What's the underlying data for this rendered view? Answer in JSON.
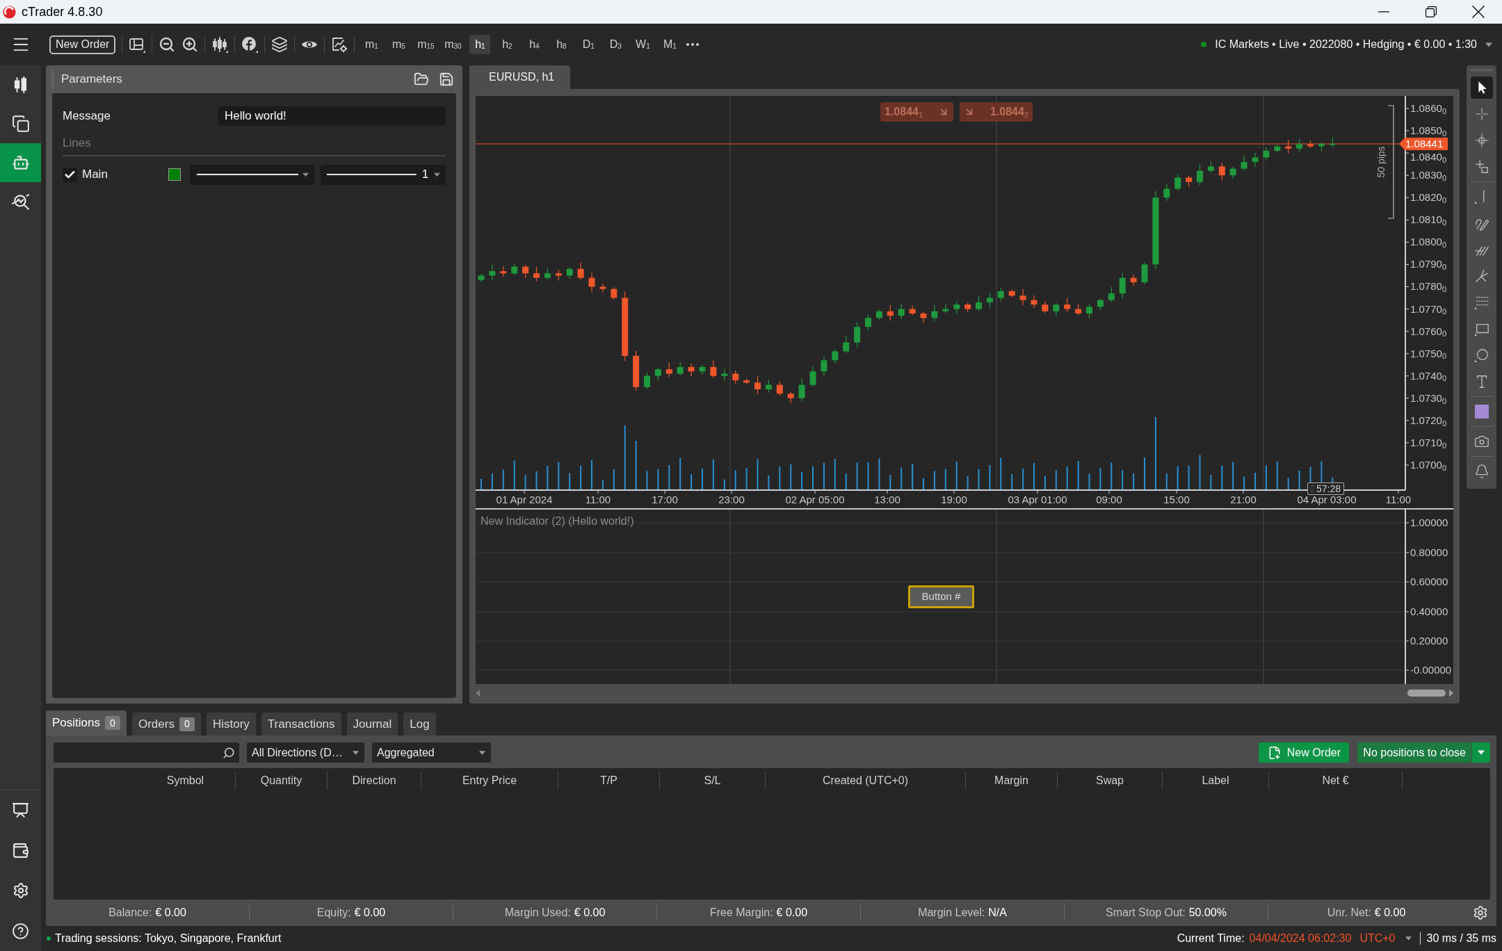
{
  "window": {
    "title": "cTrader 4.8.30"
  },
  "toolbar": {
    "new_order": "New Order",
    "timeframes": [
      {
        "label": "m$_{1}$",
        "selected": false
      },
      {
        "label": "m$_{5}$",
        "selected": false
      },
      {
        "label": "m$_{15}$",
        "selected": false
      },
      {
        "label": "m$_{30}$",
        "selected": false
      },
      {
        "label": "h$_{1}$",
        "selected": true
      },
      {
        "label": "h$_{2}$",
        "selected": false
      },
      {
        "label": "h$_{4}$",
        "selected": false
      },
      {
        "label": "h$_{8}$",
        "selected": false
      },
      {
        "label": "D$_{1}$",
        "selected": false
      },
      {
        "label": "D$_{3}$",
        "selected": false
      },
      {
        "label": "W$_{1}$",
        "selected": false
      },
      {
        "label": "M$_{1}$",
        "selected": false
      }
    ],
    "account": {
      "text": "IC Markets • Live • 2022080 • Hedging • € 0.00 • 1:30",
      "connected": true
    }
  },
  "sidebar": {
    "items": [
      {
        "selected": false
      },
      {
        "selected": false
      },
      {
        "selected": true
      },
      {
        "selected": false
      }
    ]
  },
  "parameters": {
    "title": "Parameters",
    "message": {
      "label": "Message",
      "value": "Hello world!"
    },
    "section": "Lines",
    "lines": [
      {
        "label": "Main",
        "checked": true,
        "color": "#008000",
        "thickness": "1"
      }
    ]
  },
  "chart": {
    "tab": "EURUSD, h1",
    "quick_trade": [
      {
        "kind": "sell",
        "price": "1.0844$_{1}$"
      },
      {
        "kind": "buy",
        "price": "1.0844$_{2}$"
      }
    ],
    "price_ticks": [
      "1.0860$_{0}$",
      "1.0850$_{0}$",
      "1.0840$_{0}$",
      "1.0830$_{0}$",
      "1.0820$_{0}$",
      "1.0810$_{0}$",
      "1.0800$_{0}$",
      "1.0790$_{0}$",
      "1.0780$_{0}$",
      "1.0770$_{0}$",
      "1.0760$_{0}$",
      "1.0750$_{0}$",
      "1.0740$_{0}$",
      "1.0730$_{0}$",
      "1.0720$_{0}$",
      "1.0710$_{0}$",
      "1.0700$_{0}$"
    ],
    "current_price": "1.08441",
    "pips_label": "50 pips",
    "time_labels": [
      "01 Apr 2024",
      "11:00",
      "17:00",
      "23:00",
      "02 Apr 05:00",
      "13:00",
      "19:00",
      "03 Apr 01:00",
      "09:00",
      "15:00",
      "21:00",
      "04 Apr 03:00",
      "11:00"
    ],
    "countdown": "57:28"
  },
  "indicator": {
    "title": "New Indicator (2) (Hello world!)",
    "button": "Button #",
    "ticks": [
      "1.00000",
      "0.80000",
      "0.60000",
      "0.40000",
      "0.20000",
      "-0.00000"
    ]
  },
  "drawing_tools": {
    "tools": [
      {
        "selected": true
      },
      {
        "selected": false
      },
      {
        "selected": false
      },
      {
        "selected": false
      },
      {
        "selected": false
      },
      {
        "selected": false
      },
      {
        "selected": false
      },
      {
        "selected": false
      },
      {
        "selected": false
      },
      {
        "selected": false
      },
      {
        "selected": false
      },
      {
        "selected": false
      }
    ],
    "color": "#a48ad3"
  },
  "bottom_panel": {
    "tabs": [
      {
        "label": "Positions",
        "count": "0",
        "selected": true
      },
      {
        "label": "Orders",
        "count": "0",
        "selected": false
      },
      {
        "label": "History",
        "selected": false
      },
      {
        "label": "Transactions",
        "selected": false
      },
      {
        "label": "Journal",
        "selected": false
      },
      {
        "label": "Log",
        "selected": false
      }
    ],
    "filters": [
      "All Directions (D…",
      "Aggregated"
    ],
    "new_order": "New Order",
    "close_positions": "No positions to close",
    "columns": [
      "Symbol",
      "Quantity",
      "Direction",
      "Entry Price",
      "T/P",
      "S/L",
      "Created (UTC+0)",
      "Margin",
      "Swap",
      "Label",
      "Net €"
    ],
    "summary": [
      {
        "label": "Balance:",
        "value": "€ 0.00"
      },
      {
        "label": "Equity:",
        "value": "€ 0.00"
      },
      {
        "label": "Margin Used:",
        "value": "€ 0.00"
      },
      {
        "label": "Free Margin:",
        "value": "€ 0.00"
      },
      {
        "label": "Margin Level:",
        "value": "N/A"
      },
      {
        "label": "Smart Stop Out:",
        "value": "50.00%"
      },
      {
        "label": "Unr. Net:",
        "value": "€ 0.00"
      }
    ]
  },
  "status_bar": {
    "online": true,
    "sessions": "Trading sessions: Tokyo, Singapore, Frankfurt",
    "time_label": "Current Time:",
    "time": "04/04/2024 06:02:30",
    "timezone": "UTC+0",
    "latency": "30 ms / 35 ms"
  }
}
